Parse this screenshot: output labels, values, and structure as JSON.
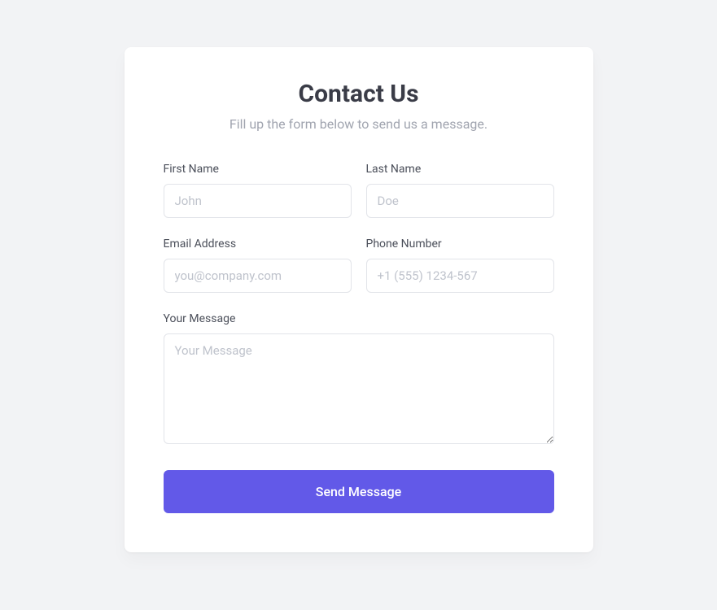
{
  "header": {
    "title": "Contact Us",
    "subtitle": "Fill up the form below to send us a message."
  },
  "fields": {
    "first_name": {
      "label": "First Name",
      "placeholder": "John",
      "value": ""
    },
    "last_name": {
      "label": "Last Name",
      "placeholder": "Doe",
      "value": ""
    },
    "email": {
      "label": "Email Address",
      "placeholder": "you@company.com",
      "value": ""
    },
    "phone": {
      "label": "Phone Number",
      "placeholder": "+1 (555) 1234-567",
      "value": ""
    },
    "message": {
      "label": "Your Message",
      "placeholder": "Your Message",
      "value": ""
    }
  },
  "submit_label": "Send Message"
}
